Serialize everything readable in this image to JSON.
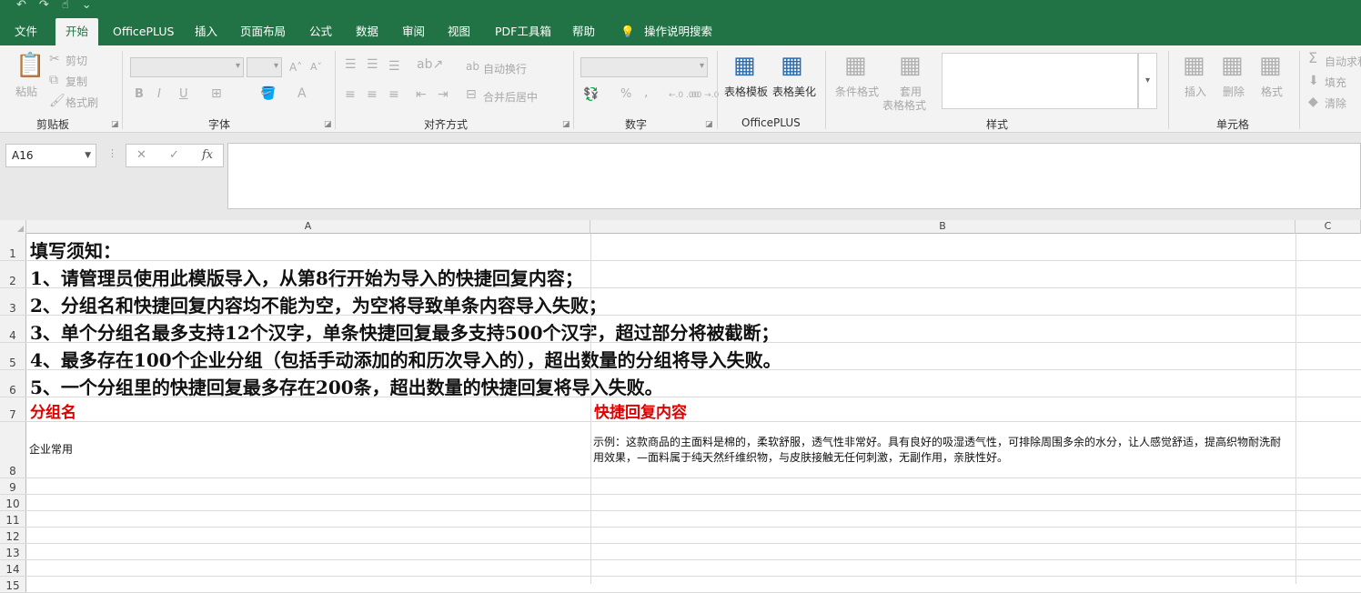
{
  "quick_access": {
    "undo": "↶",
    "redo": "↷",
    "touch": "☝",
    "more": "⌄"
  },
  "tabs": [
    "文件",
    "开始",
    "OfficePLUS",
    "插入",
    "页面布局",
    "公式",
    "数据",
    "审阅",
    "视图",
    "PDF工具箱",
    "帮助"
  ],
  "active_tab": "开始",
  "search": {
    "icon": "lightbulb-icon",
    "label": "操作说明搜索"
  },
  "ribbon": {
    "clipboard": {
      "paste": "粘贴",
      "cut": "剪切",
      "copy": "复制",
      "format_painter": "格式刷",
      "group": "剪贴板"
    },
    "font": {
      "bold": "B",
      "italic": "I",
      "underline": "U",
      "grow": "A˄",
      "shrink": "A˅",
      "font_color": "A",
      "group": "字体"
    },
    "alignment": {
      "wrap": "自动换行",
      "merge": "合并后居中",
      "group": "对齐方式"
    },
    "number": {
      "percent": "%",
      "comma": ",",
      "inc_dec": "←.0 .00",
      "dec_dec": ".00 →.0",
      "group": "数字"
    },
    "officeplus": {
      "table_template": "表格模板",
      "table_beautify": "表格美化",
      "group": "OfficePLUS"
    },
    "styles": {
      "conditional": "条件格式",
      "table_format_1": "套用",
      "table_format_2": "表格格式",
      "group": "样式"
    },
    "cells": {
      "insert": "插入",
      "delete": "删除",
      "format": "格式",
      "group": "单元格"
    },
    "editing": {
      "autosum": "自动求和",
      "fill": "填充",
      "clear": "清除"
    }
  },
  "formula_bar": {
    "name_box": "A16",
    "cancel": "✕",
    "enter": "✓",
    "fx": "fx",
    "value": ""
  },
  "columns": [
    "A",
    "B",
    "C"
  ],
  "row_numbers": [
    "1",
    "2",
    "3",
    "4",
    "5",
    "6",
    "7",
    "8",
    "9",
    "10",
    "11",
    "12",
    "13",
    "14",
    "15"
  ],
  "cells": {
    "A1": "填写须知：",
    "A2": "1、请管理员使用此模版导入，从第8行开始为导入的快捷回复内容；",
    "A3": "2、分组名和快捷回复内容均不能为空，为空将导致单条内容导入失败；",
    "A4": "3、单个分组名最多支持12个汉字，单条快捷回复最多支持500个汉字，超过部分将被截断；",
    "A5": "4、最多存在100个企业分组（包括手动添加的和历次导入的），超出数量的分组将导入失败。",
    "A6": "5、一个分组里的快捷回复最多存在200条，超出数量的快捷回复将导入失败。",
    "A7": "分组名",
    "B7": "快捷回复内容",
    "A8": "企业常用",
    "B8": "示例：这款商品的主面料是棉的，柔软舒服，透气性非常好。具有良好的吸湿透气性，可排除周围多余的水分，让人感觉舒适，提高织物耐洗耐用效果，—面料属于纯天然纤维织物，与皮肤接触无任何刺激，无副作用，亲肤性好。"
  },
  "colors": {
    "accent": "#217346",
    "header_red": "#e00000"
  }
}
